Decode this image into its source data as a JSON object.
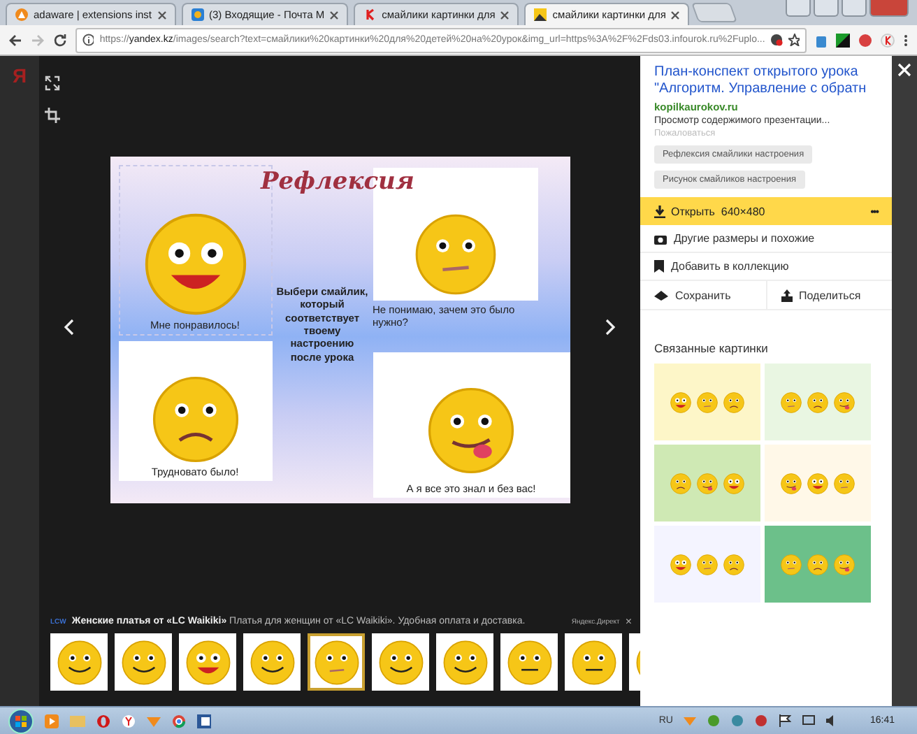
{
  "browser": {
    "tabs": [
      {
        "title": "adaware | extensions inst",
        "selected": false
      },
      {
        "title": "(3) Входящие - Почта M",
        "selected": false
      },
      {
        "title": "смайлики картинки для",
        "selected": false
      },
      {
        "title": "смайлики картинки для",
        "selected": true
      }
    ],
    "url_scheme": "https://",
    "url_host": "yandex.kz",
    "url_path": "/images/search?text=смайлики%20картинки%20для%20детей%20на%20урок&img_url=https%3A%2F%2Fds03.infourok.ru%2Fuplo..."
  },
  "page_behind": {
    "logo": "Я"
  },
  "slide": {
    "title": "Рефлексия",
    "prompt": "Выбери смайлик, который соответствует твоему настроению после урока",
    "captions": [
      "Мне понравилось!",
      "Не понимаю, зачем это было нужно?",
      "Трудновато было!",
      "А я все это знал и без вас!"
    ]
  },
  "ad": {
    "logo": "LCW",
    "text": "**Женские платья от «LC Waikiki»** Платья для женщин от «LC Waikiki». Удобная оплата и доставка.",
    "source": "Яндекс.Директ",
    "close": "×"
  },
  "thumbnails": [
    {
      "selected": false
    },
    {
      "selected": false
    },
    {
      "selected": false
    },
    {
      "selected": false
    },
    {
      "selected": true
    },
    {
      "selected": false
    },
    {
      "selected": false
    },
    {
      "selected": false
    },
    {
      "selected": false
    },
    {
      "selected": false
    }
  ],
  "panel": {
    "title": "План-конспект открытого урока \"Алгоритм. Управление с обратн",
    "source": "kopilkaurokov.ru",
    "description": "Просмотр содержимого презентации...",
    "report": "Пожаловаться",
    "tags": [
      "Рефлексия смайлики настроения",
      "Рисунок смайликов настроения"
    ],
    "open_button": "Открыть  640×480",
    "more": "•••",
    "actions": [
      {
        "kind": "similar",
        "label": "Другие размеры и похожие"
      },
      {
        "kind": "collection",
        "label": "Добавить в коллекцию"
      }
    ],
    "save": "Сохранить",
    "share": "Поделиться",
    "related_title": "Связанные картинки"
  },
  "taskbar": {
    "language": "RU",
    "time": "16:41"
  }
}
